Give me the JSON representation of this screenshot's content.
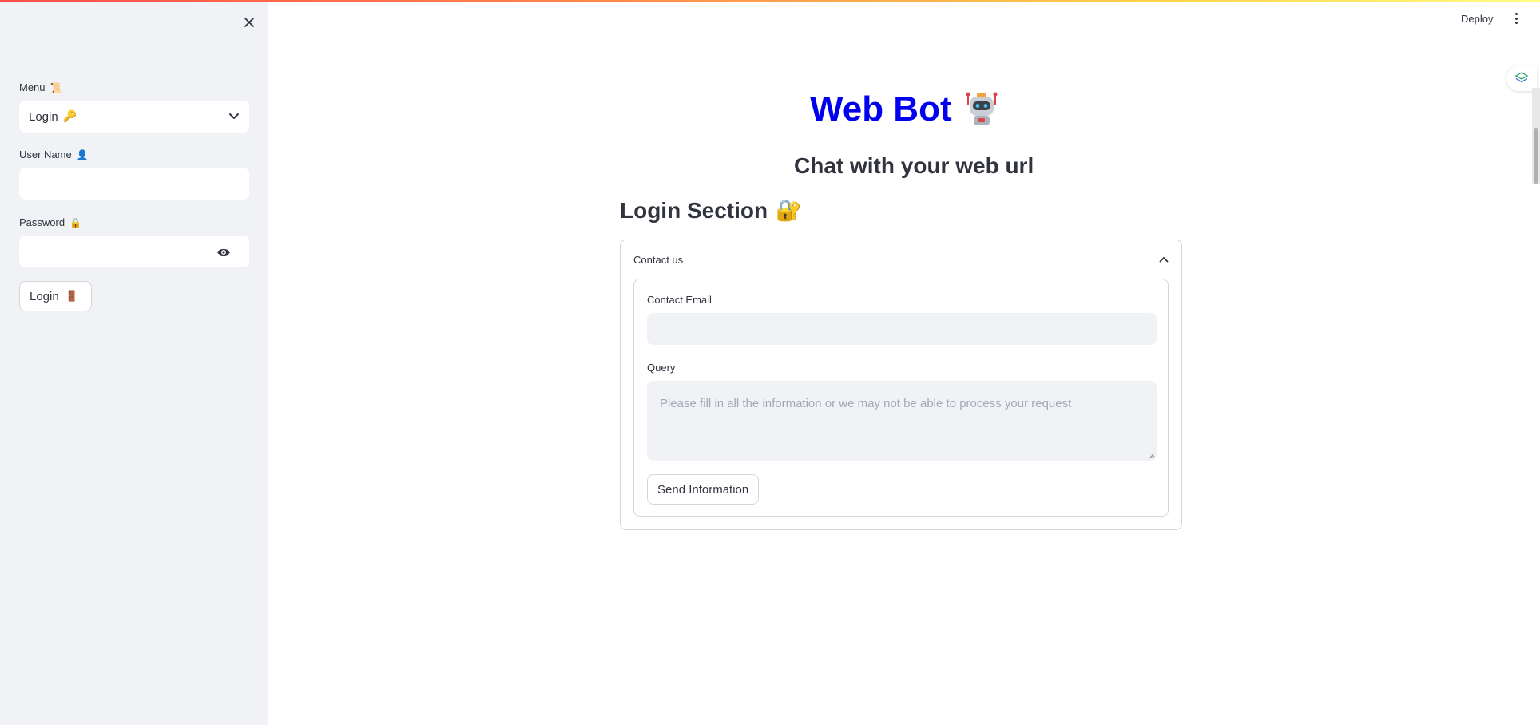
{
  "sidebar": {
    "menu_label": "Menu",
    "menu_emoji": "📜",
    "menu_selected": "Login",
    "menu_selected_emoji": "🔑",
    "username_label": "User Name",
    "username_emoji": "👤",
    "username_value": "",
    "password_label": "Password",
    "password_emoji": "🔒",
    "password_value": "",
    "login_button": "Login",
    "login_button_emoji": "🚪"
  },
  "header": {
    "deploy_label": "Deploy"
  },
  "main": {
    "title": "Web Bot",
    "subtitle": "Chat with your web url",
    "section_title": "Login Section",
    "section_emoji": "🔐",
    "expander": {
      "label": "Contact us",
      "email_label": "Contact Email",
      "email_value": "",
      "query_label": "Query",
      "query_placeholder": "Please fill in all the information or we may not be able to process your request",
      "send_button": "Send Information"
    }
  },
  "colors": {
    "title": "#0000ee",
    "sidebar_bg": "#f0f2f6",
    "text": "#31333f"
  }
}
